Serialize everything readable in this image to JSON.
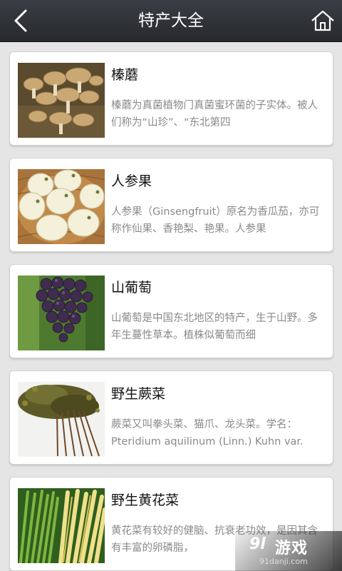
{
  "header": {
    "title": "特产大全",
    "back_icon": "chevron-left-icon",
    "home_icon": "home-icon"
  },
  "items": [
    {
      "name": "榛蘑",
      "desc": "榛蘑为真菌植物门真菌蜜环菌的子实体。被人们称为“山珍”、“东北第四",
      "image": "hazel-mushroom-photo"
    },
    {
      "name": "人参果",
      "desc": "人参果（Ginsengfruit）原名为香瓜茄，亦可称作仙果、香艳梨、艳果。人参果",
      "image": "ginseng-fruit-photo"
    },
    {
      "name": "山葡萄",
      "desc": "山葡萄是中国东北地区的特产，生于山野。多年生蔓性草本。植株似葡萄而细",
      "image": "wild-grape-photo"
    },
    {
      "name": "野生蕨菜",
      "desc": "蕨菜又叫拳头菜、猫爪、龙头菜。学名：Pteridium aquilinum (Linn.) Kuhn var.",
      "image": "wild-bracken-photo"
    },
    {
      "name": "野生黄花菜",
      "desc": "黄花菜有较好的健脑、抗衰老功效，是因其含有丰富的卵磷脂，",
      "image": "daylily-photo"
    }
  ],
  "watermark": {
    "logo": "9l",
    "text": "游戏",
    "domain": "91danji.com"
  },
  "colors": {
    "header_bg": "#2e3035",
    "page_bg": "#e5e5e5",
    "card_bg": "#ffffff",
    "title_text": "#111111",
    "desc_text": "#8a8a8a"
  }
}
